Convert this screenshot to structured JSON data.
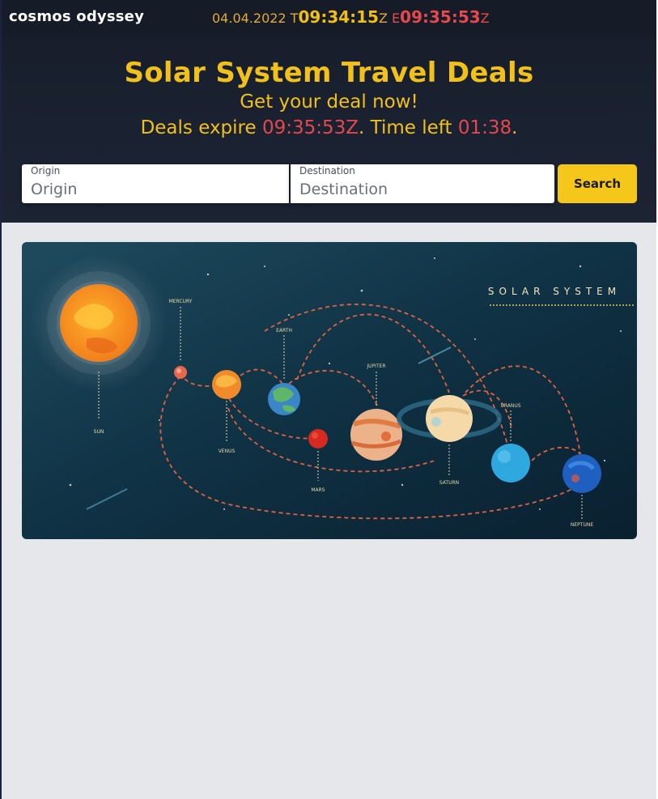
{
  "header": {
    "brand": "cosmos odyssey",
    "clock": {
      "date": "04.04.2022",
      "t_prefix": "T",
      "time": "09:34:15",
      "zone": "Z",
      "e_prefix": "E",
      "expiry_time": "09:35:53",
      "expiry_zone": "Z"
    }
  },
  "hero": {
    "title": "Solar System Travel Deals",
    "subtitle": "Get your deal now!",
    "expire_prefix": "Deals expire ",
    "expire_time": "09:35:53Z",
    "time_left_prefix": ". Time left ",
    "time_left": "01:38",
    "expire_suffix": "."
  },
  "search": {
    "origin_label": "Origin",
    "origin_placeholder": "Origin",
    "origin_value": "",
    "destination_label": "Destination",
    "destination_placeholder": "Destination",
    "destination_value": "",
    "button_label": "Search"
  },
  "banner": {
    "heading": "SOLAR SYSTEM",
    "labels": {
      "sun": "SUN",
      "mercury": "MERCURY",
      "venus": "VENUS",
      "earth": "EARTH",
      "mars": "MARS",
      "jupiter": "JUPITER",
      "saturn": "SATURN",
      "uranus": "URANUS",
      "neptune": "NEPTUNE"
    }
  },
  "colors": {
    "accent_yellow": "#f2c01a",
    "alert_red": "#e5484d",
    "hero_bg": "#1a2130",
    "button_yellow": "#f6c71b"
  }
}
